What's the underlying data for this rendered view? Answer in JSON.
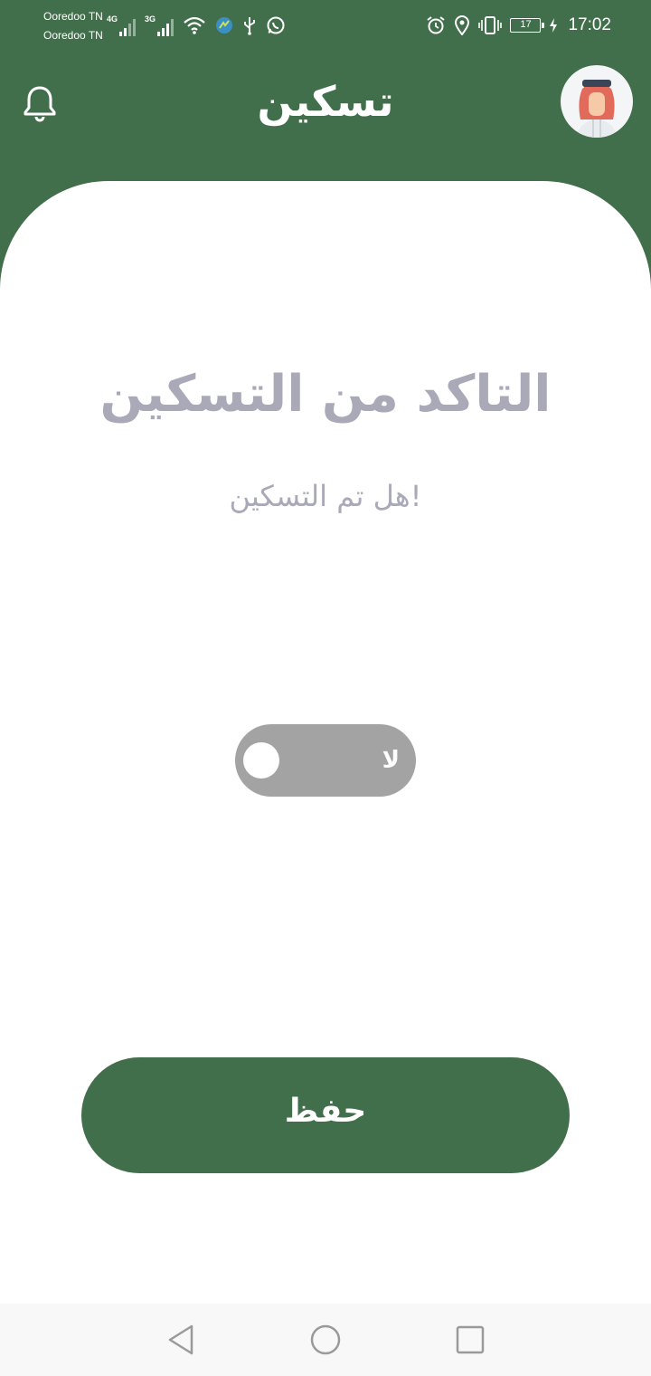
{
  "status_bar": {
    "carrier_1": "Ooredoo TN",
    "carrier_2": "Ooredoo TN",
    "network_1": "4G",
    "network_2": "3G",
    "battery_level": "17",
    "time": "17:02"
  },
  "header": {
    "title": "تسكين",
    "notification_icon": "bell-icon",
    "avatar_icon": "user-avatar"
  },
  "main": {
    "title": "التاكد من التسكين",
    "question": "هل تم التسكين!",
    "toggle": {
      "label": "لا",
      "checked": false
    },
    "save_label": "حفظ"
  },
  "nav_bar": {
    "back_icon": "back-triangle-icon",
    "home_icon": "home-circle-icon",
    "recents_icon": "recents-square-icon"
  },
  "colors": {
    "primary": "#426f4b",
    "title_text": "#aaa9b8",
    "toggle_off": "#a3a3a3"
  }
}
